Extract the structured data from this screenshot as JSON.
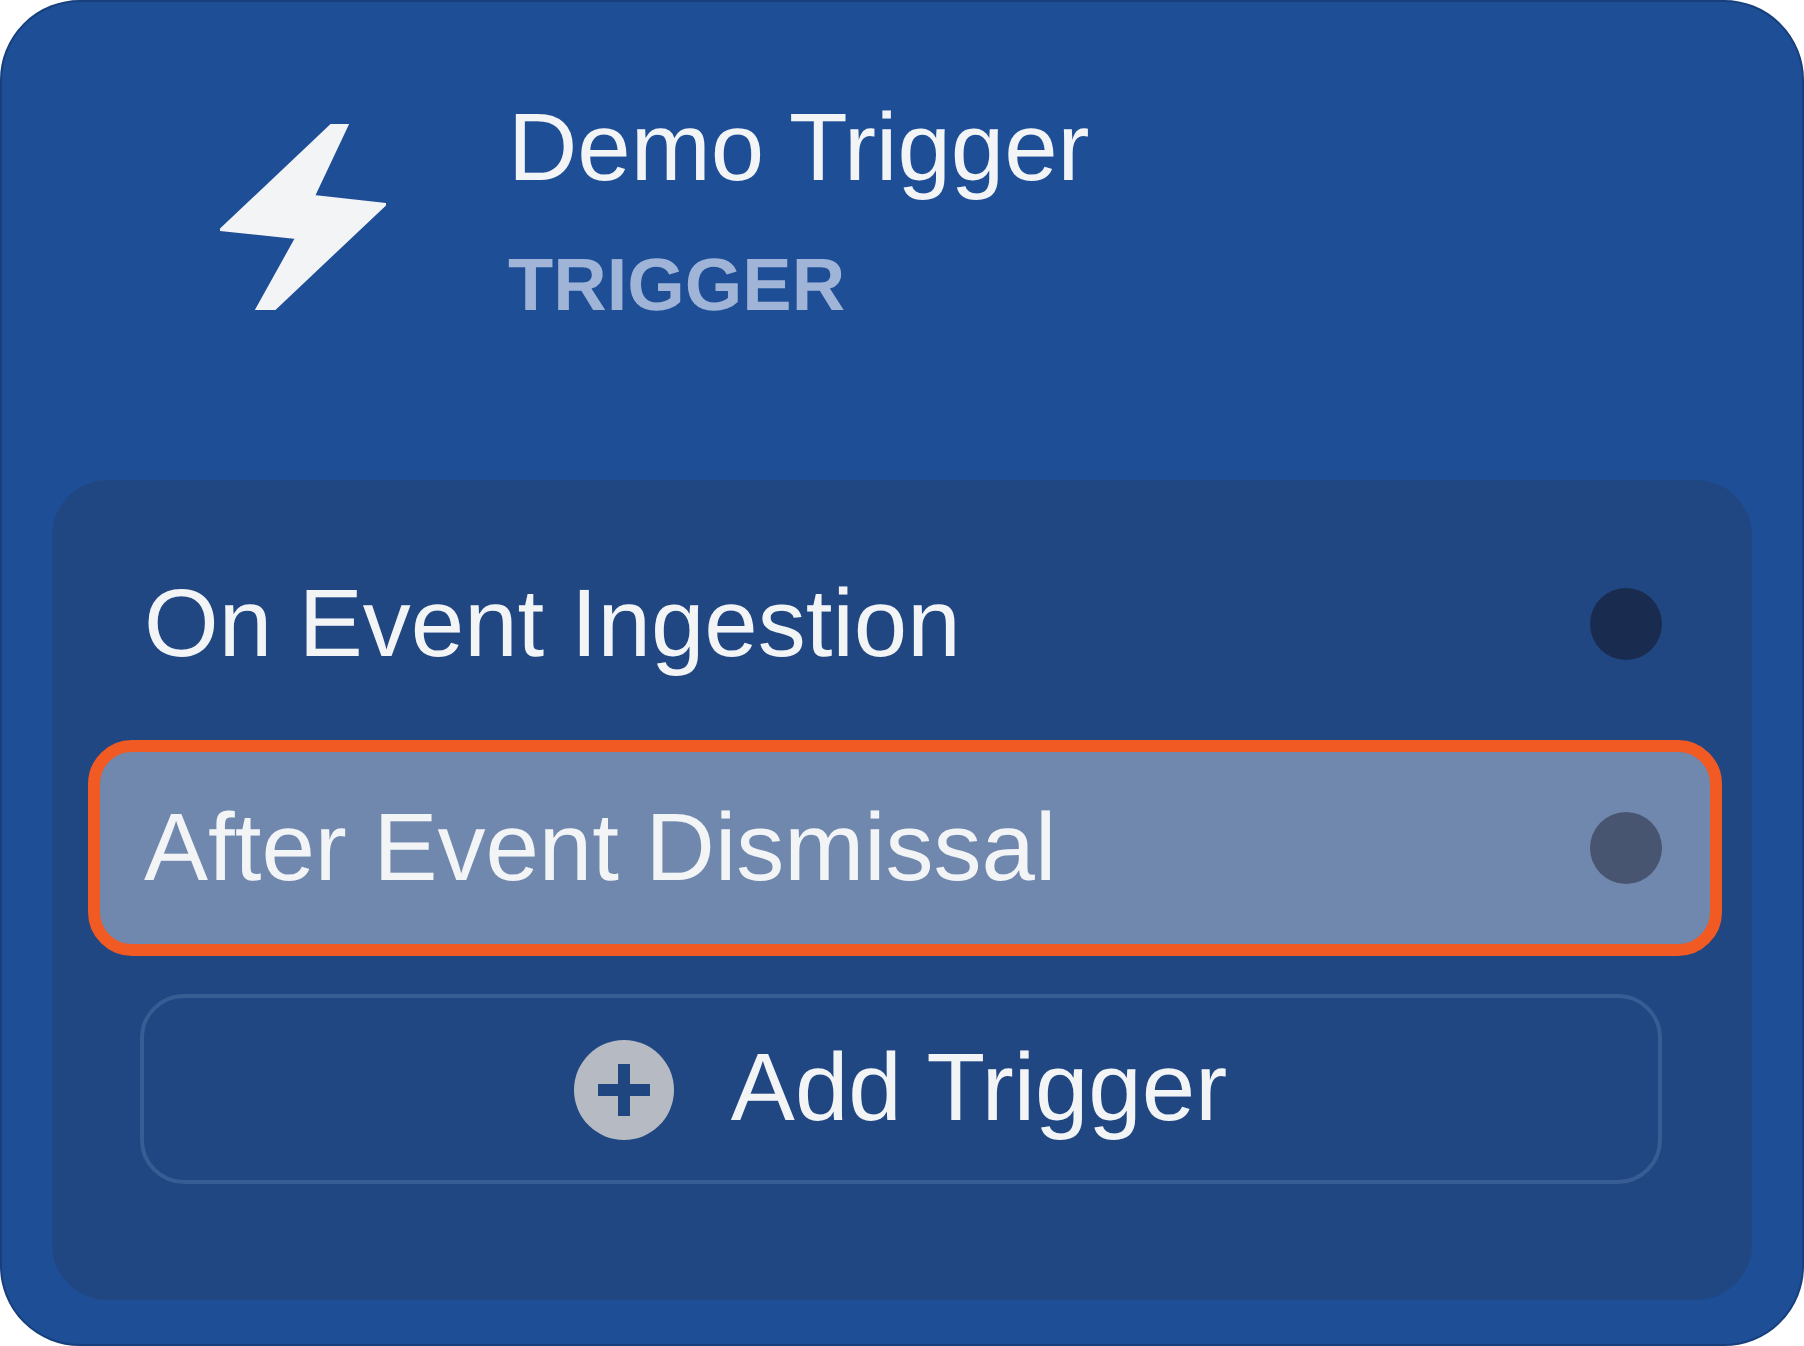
{
  "node": {
    "title": "Demo Trigger",
    "subtitle": "TRIGGER"
  },
  "triggers": [
    {
      "label": "On Event Ingestion",
      "selected": false
    },
    {
      "label": "After Event Dismissal",
      "selected": true
    }
  ],
  "add_button": {
    "label": "Add Trigger"
  }
}
